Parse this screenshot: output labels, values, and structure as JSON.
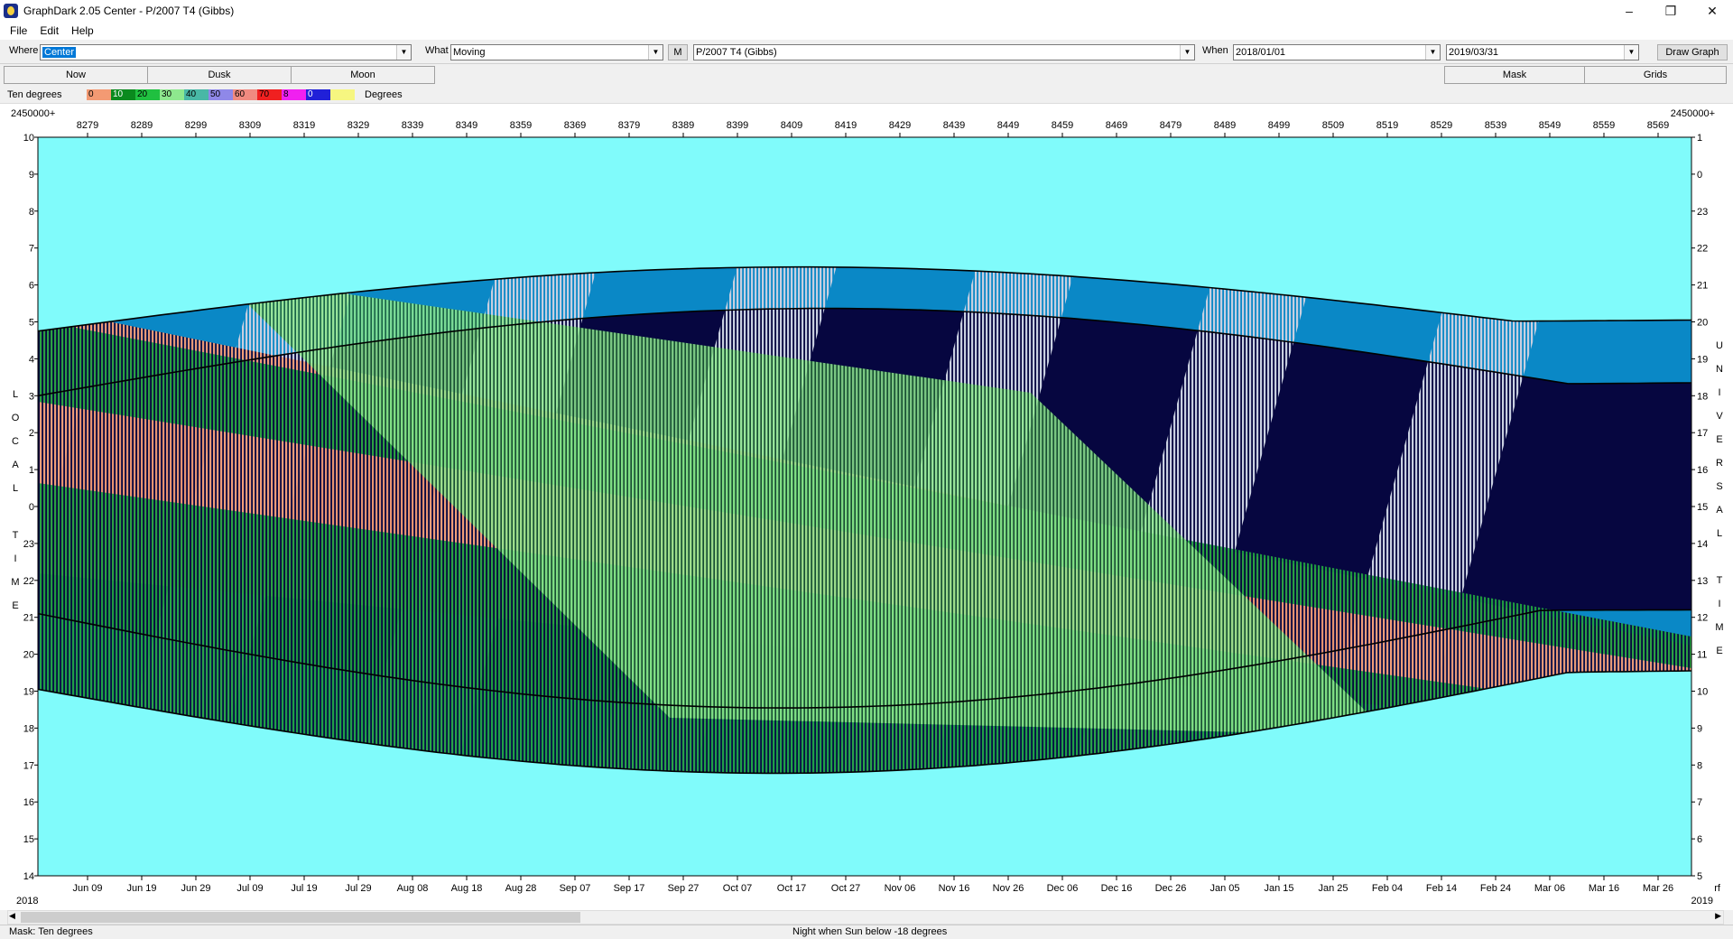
{
  "window": {
    "title": "GraphDark 2.05  Center  -  P/2007 T4 (Gibbs)"
  },
  "menu": [
    "File",
    "Edit",
    "Help"
  ],
  "toolbar": {
    "where_label": "Where",
    "where_value": "Center",
    "what_label": "What",
    "what_value": "Moving",
    "m_button": "M",
    "object_value": "P/2007 T4 (Gibbs)",
    "when_label": "When",
    "when_start": "2018/01/01",
    "when_end": "2019/03/31",
    "draw_button": "Draw Graph"
  },
  "tabs": {
    "now": "Now",
    "dusk": "Dusk",
    "moon": "Moon",
    "mask": "Mask",
    "grids": "Grids"
  },
  "legend": {
    "label": "Ten degrees",
    "units": "Degrees",
    "bands": [
      {
        "text": "0",
        "color": "#f39a73"
      },
      {
        "text": "10",
        "color": "#0a8a1e"
      },
      {
        "text": "20",
        "color": "#20c040"
      },
      {
        "text": "30",
        "color": "#8ee88e"
      },
      {
        "text": "40",
        "color": "#49b8a6"
      },
      {
        "text": "50",
        "color": "#8f88e8"
      },
      {
        "text": "60",
        "color": "#f08a80"
      },
      {
        "text": "70",
        "color": "#f02020"
      },
      {
        "text": "8",
        "color": "#f020f0"
      },
      {
        "text": "0",
        "color": "#2020d8"
      },
      {
        "text": "",
        "color": "#f6f680"
      }
    ]
  },
  "graph": {
    "jd_prefix": "2450000+",
    "year_left": "2018",
    "year_right": "2019",
    "jd_ticks": [
      "8279",
      "8289",
      "8299",
      "8309",
      "8319",
      "8329",
      "8339",
      "8349",
      "8359",
      "8369",
      "8379",
      "8389",
      "8399",
      "8409",
      "8419",
      "8429",
      "8439",
      "8449",
      "8459",
      "8469",
      "8479",
      "8489",
      "8499",
      "8509",
      "8519",
      "8529",
      "8539",
      "8549",
      "8559",
      "8569"
    ],
    "date_ticks": [
      "Jun 09",
      "Jun 19",
      "Jun 29",
      "Jul 09",
      "Jul 19",
      "Jul 29",
      "Aug 08",
      "Aug 18",
      "Aug 28",
      "Sep 07",
      "Sep 17",
      "Sep 27",
      "Oct 07",
      "Oct 17",
      "Oct 27",
      "Nov 06",
      "Nov 16",
      "Nov 26",
      "Dec 06",
      "Dec 16",
      "Dec 26",
      "Jan 05",
      "Jan 15",
      "Jan 25",
      "Feb 04",
      "Feb 14",
      "Feb 24",
      "Mar 06",
      "Mar 16",
      "Mar 26"
    ],
    "local_hours": [
      "10",
      "9",
      "8",
      "7",
      "6",
      "5",
      "4",
      "3",
      "2",
      "1",
      "0",
      "23",
      "22",
      "21",
      "20",
      "19",
      "18",
      "17",
      "16",
      "15",
      "14"
    ],
    "ut_hours": [
      "1",
      "0",
      "23",
      "22",
      "21",
      "20",
      "19",
      "18",
      "17",
      "16",
      "15",
      "14",
      "13",
      "12",
      "11",
      "10",
      "9",
      "8",
      "7",
      "6",
      "5"
    ],
    "left_axis_letters": [
      "L",
      "O",
      "C",
      "A",
      "L",
      "",
      "T",
      "I",
      "M",
      "E"
    ],
    "right_axis_letters": [
      "U",
      "N",
      "I",
      "V",
      "E",
      "R",
      "S",
      "A",
      "L",
      "",
      "T",
      "I",
      "M",
      "E"
    ],
    "corner_right": "rf",
    "colors": {
      "day": "#80fbfb",
      "night": "#060640",
      "twilight": "#0a88c6",
      "moonlit": "#c8cfe0"
    }
  },
  "status": {
    "left": "Mask:  Ten degrees",
    "center": "Night when Sun below -18 degrees"
  }
}
